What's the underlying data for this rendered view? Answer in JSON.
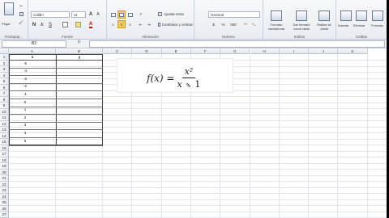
{
  "ribbon": {
    "clipboard": {
      "paste_label": "Pegar",
      "group_label": "Portapap..."
    },
    "font": {
      "font_name": "Calibri",
      "font_size": "11",
      "bold": "N",
      "italic": "K",
      "underline": "S",
      "grow_label": "A",
      "shrink_label": "A",
      "font_color_label": "A",
      "group_label": "Fuente"
    },
    "alignment": {
      "wrap_label": "Ajustar texto",
      "merge_label": "Combinar y centrar",
      "group_label": "Alineación"
    },
    "number": {
      "format_value": "General",
      "currency_label": "$",
      "percent_label": "%",
      "thousands_label": "000",
      "group_label": "Número"
    },
    "styles": {
      "conditional_label": "Formato\ncondicional",
      "table_label": "Dar formato\ncomo tabla",
      "cell_styles_label": "Estilos de\ncelda",
      "group_label": "Estilos"
    },
    "cells": {
      "insert_label": "Insertar",
      "delete_label": "Eliminar",
      "format_label": "Formato",
      "group_label": "Celdas"
    }
  },
  "formula_bar": {
    "name_box": "B2",
    "fx_label": "fx",
    "formula_value": ""
  },
  "grid": {
    "columns": [
      "A",
      "B",
      "C",
      "D",
      "E",
      "F",
      "G",
      "H",
      "I",
      "J",
      "K"
    ],
    "rows": [
      "1",
      "2",
      "3",
      "4",
      "5",
      "6",
      "7",
      "8",
      "9",
      "10",
      "11",
      "12",
      "13",
      "14",
      "15",
      "16",
      "17",
      "18",
      "19",
      "20",
      "21",
      "22",
      "23",
      "24",
      "25",
      "26",
      "27"
    ],
    "table": {
      "header_x": "x",
      "header_y": "y",
      "x_values": [
        "-5",
        "-4",
        "-3",
        "-2",
        "-1",
        "0",
        "1",
        "2",
        "3",
        "4",
        "5"
      ]
    }
  },
  "formula_image": {
    "lhs": "f(x) =",
    "numerator": "x²",
    "denominator_left": "x",
    "denominator_right": "1"
  },
  "colors": {
    "ribbon_bg": "#e9ecf1",
    "highlight_orange": "#f5c46b",
    "grid_line": "#e1e5ea",
    "header_bg": "#e4e8ee"
  }
}
